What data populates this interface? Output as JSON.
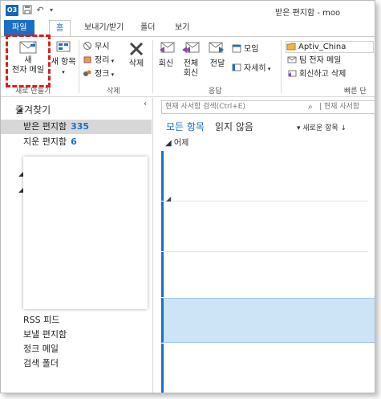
{
  "window": {
    "title": "받은 편지함 - moo",
    "app_icon": "O3"
  },
  "qat": {
    "save_icon": "save-icon",
    "undo_icon": "undo-icon",
    "customize_icon": "customize-icon"
  },
  "tabs": [
    {
      "label": "파일"
    },
    {
      "label": "홈"
    },
    {
      "label": "보내기/받기"
    },
    {
      "label": "폴더"
    },
    {
      "label": "보기"
    }
  ],
  "ribbon": {
    "new_group": {
      "new_mail_label": "새\n전자 메일",
      "new_items_label": "새 항목",
      "group_label": "새로 만들기"
    },
    "delete_group": {
      "ignore_label": "무시",
      "cleanup_label": "정리",
      "junk_label": "정크",
      "delete_label": "삭제",
      "group_label": "삭제"
    },
    "respond_group": {
      "reply_label": "회신",
      "reply_all_label": "전체\n회신",
      "forward_label": "전달",
      "meeting_label": "모임",
      "more_label": "자세히",
      "group_label": "응답"
    },
    "quicksteps_group": {
      "items": [
        "Aptiv_China",
        "팀 전자 메일",
        "회신하고 삭제"
      ],
      "group_label": "빠른 단"
    }
  },
  "folderpane": {
    "favorites_label": "즐겨찾기",
    "items": [
      {
        "label": "받은 편지함",
        "count": "335"
      },
      {
        "label": "지운 편지함",
        "count": "6"
      }
    ],
    "lower_items": [
      {
        "label": "RSS 피드"
      },
      {
        "label": "보낼 편지함"
      },
      {
        "label": "정크 메일"
      },
      {
        "label": "검색 폴더"
      }
    ]
  },
  "messagelist": {
    "search_placeholder": "현재 사서함 검색(Ctrl+E)",
    "search_scope": "현재 사서함",
    "filter_all": "모든 항목",
    "filter_unread": "읽지 않음",
    "sort_label": "새로운 항목",
    "group_header": "어제"
  },
  "colors": {
    "accent": "#1a6fc4",
    "highlight": "#d42020",
    "selection": "#cde3f6"
  }
}
